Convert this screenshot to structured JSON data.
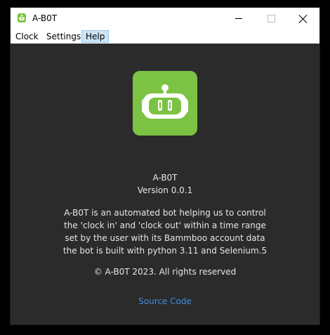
{
  "window": {
    "title": "A-B0T"
  },
  "menu": {
    "items": [
      {
        "label": "Clock"
      },
      {
        "label": "Settings"
      },
      {
        "label": "Help"
      }
    ]
  },
  "about": {
    "app_name": "A-B0T",
    "version": "Version 0.0.1",
    "description": [
      "A-B0T is an automated bot helping us to control",
      "the 'clock in' and 'clock out' within a time range",
      "set by the user with its Bammboo account data",
      "the bot is built with python 3.11 and Selenium.5"
    ],
    "copyright": "© A-B0T 2023. All rights reserved",
    "source_link": "Source Code"
  },
  "colors": {
    "accent_green": "#7cc243",
    "background": "#2b2b2b",
    "link": "#3d8fe5",
    "menu_highlight": "#cce4f7"
  },
  "icons": {
    "app": "robot-icon",
    "minimize": "minimize-icon",
    "maximize": "maximize-icon",
    "close": "close-icon"
  }
}
